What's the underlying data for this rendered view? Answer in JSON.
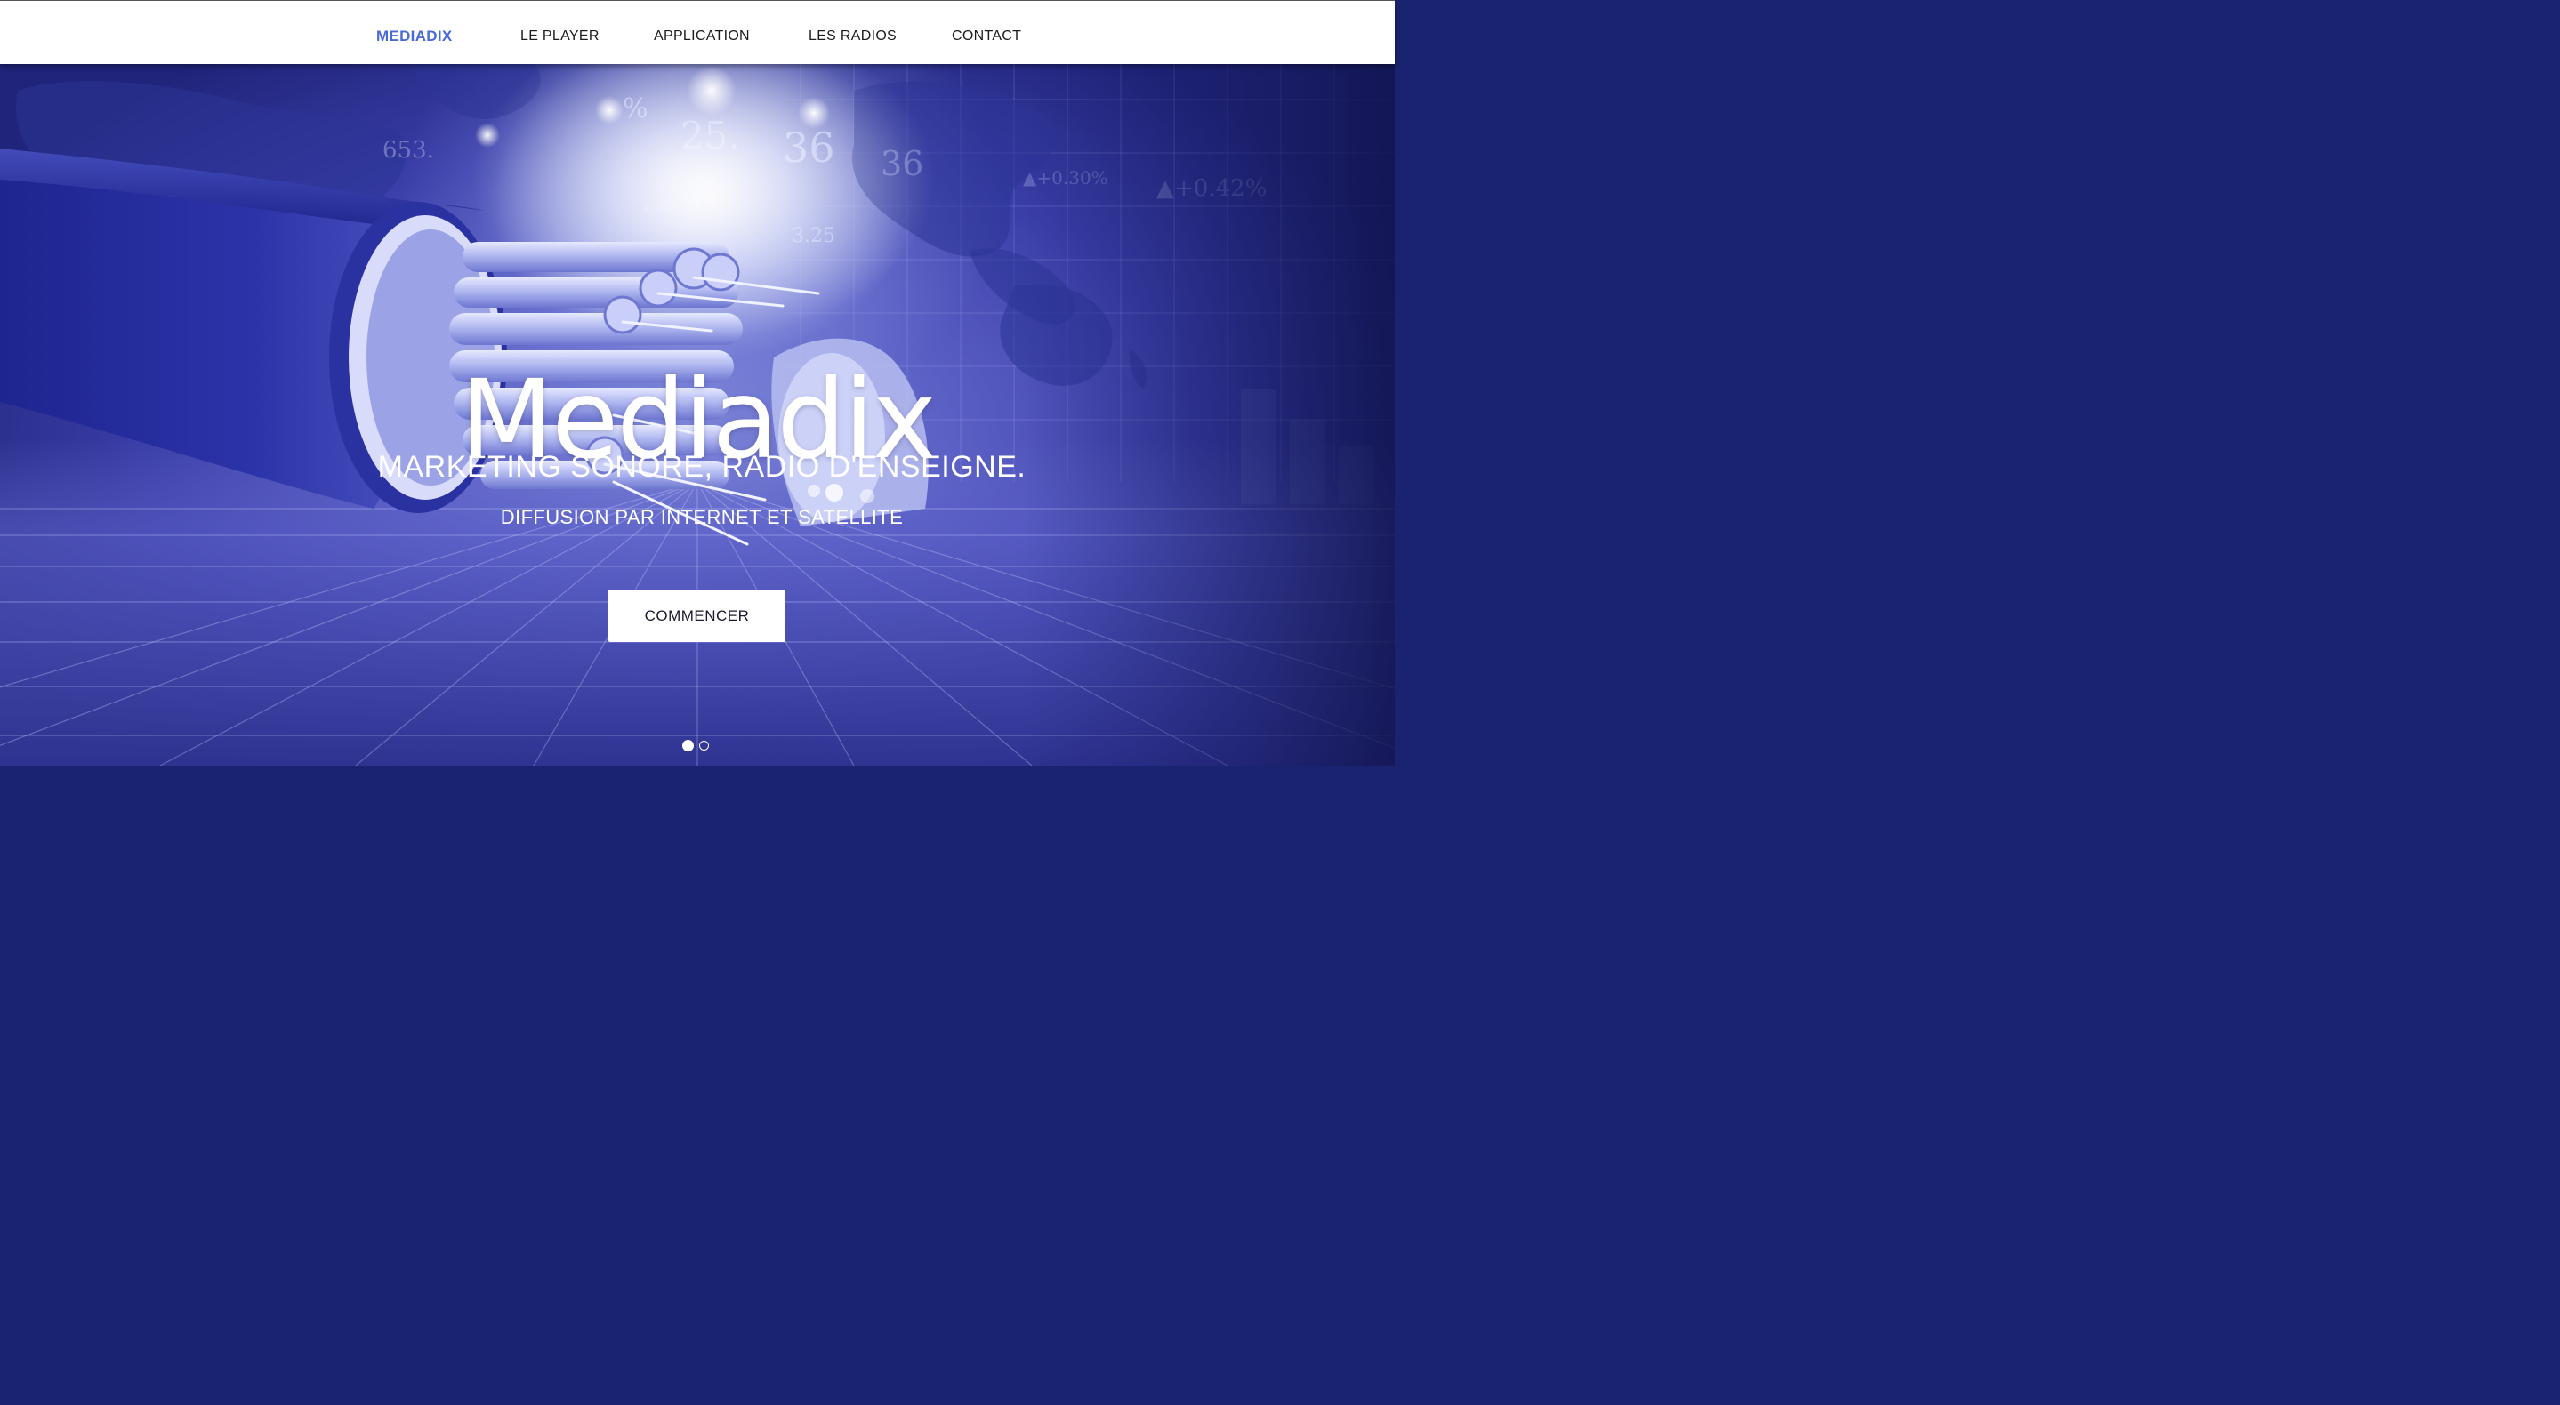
{
  "nav": {
    "items": [
      {
        "label": "MEDIADIX",
        "active": true
      },
      {
        "label": "LE PLAYER",
        "active": false
      },
      {
        "label": "APPLICATION",
        "active": false
      },
      {
        "label": "LES RADIOS",
        "active": false
      },
      {
        "label": "CONTACT",
        "active": false
      }
    ]
  },
  "hero": {
    "title": "Mediadix",
    "subtitle": "MARKETING SONORE, RADIO D'ENSEIGNE.",
    "tagline": "DIFFUSION PAR INTERNET ET SATELLITE",
    "cta_label": "COMMENCER",
    "slides": {
      "count": 2,
      "active": 1
    }
  },
  "colors": {
    "nav_active": "#4a6ad8",
    "nav_text": "#1c1c1c",
    "hero_base": "#3a3ea8",
    "hero_dark": "#20247a",
    "hero_light": "#ffffff"
  }
}
